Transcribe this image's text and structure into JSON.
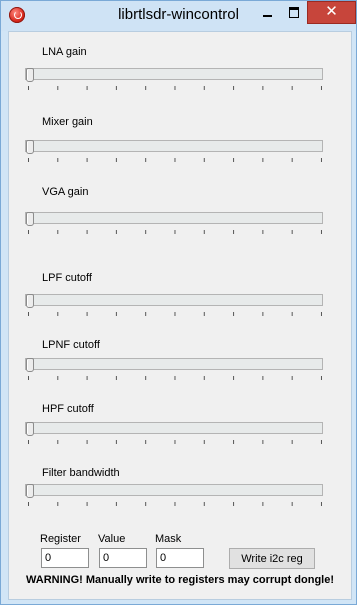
{
  "window": {
    "title": "librtlsdr-wincontrol",
    "controls": {
      "minimize": "",
      "maximize": "",
      "close": "✕"
    }
  },
  "sliders": [
    {
      "label": "LNA gain",
      "value": 0
    },
    {
      "label": "Mixer gain",
      "value": 0
    },
    {
      "label": "VGA gain",
      "value": 0
    },
    {
      "label": "LPF cutoff",
      "value": 0
    },
    {
      "label": "LPNF cutoff",
      "value": 0
    },
    {
      "label": "HPF cutoff",
      "value": 0
    },
    {
      "label": "Filter bandwidth",
      "value": 0
    }
  ],
  "i2c": {
    "register_label": "Register",
    "value_label": "Value",
    "mask_label": "Mask",
    "register_value": "0",
    "value_value": "0",
    "mask_value": "0",
    "write_button": "Write i2c reg"
  },
  "warning": "WARNING! Manually write to registers may corrupt dongle!"
}
